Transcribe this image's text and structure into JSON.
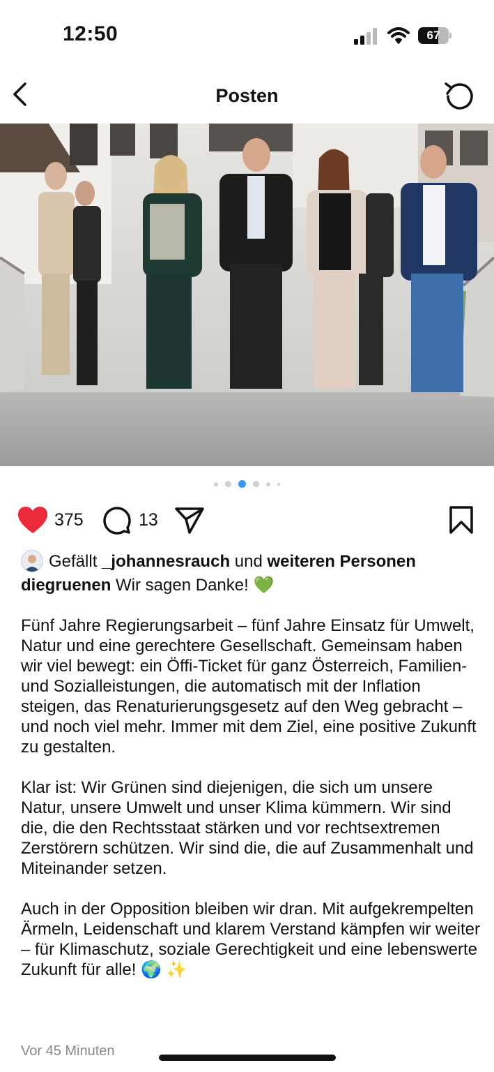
{
  "status_bar": {
    "time": "12:50",
    "battery_level": "67",
    "battery_fraction": 0.67
  },
  "nav": {
    "title": "Posten",
    "back_icon": "chevron-left-icon",
    "refresh_icon": "refresh-icon"
  },
  "carousel": {
    "total": 6,
    "active_index": 2
  },
  "actions": {
    "like_count": "375",
    "comment_count": "13",
    "like_color": "#ed2a3b"
  },
  "likes": {
    "prefix": "Gefällt",
    "user": "_johannesrauch",
    "middle": "und",
    "suffix": "weiteren Personen"
  },
  "post": {
    "author": "diegruenen",
    "headline": "Wir sagen Danke! 💚",
    "paragraphs": [
      "Fünf Jahre Regierungsarbeit – fünf Jahre Einsatz für Umwelt, Natur und eine gerechtere Gesellschaft. Gemeinsam haben wir viel bewegt: ein Öffi-Ticket für ganz Österreich, Familien- und Sozialleistungen, die automatisch mit der Inflation steigen, das Renaturierungsgesetz auf den Weg gebracht – und noch viel mehr. Immer mit dem Ziel, eine positive Zukunft zu gestalten.",
      "Klar ist: Wir Grünen sind diejenigen, die sich um unsere Natur, unsere Umwelt und unser Klima kümmern. Wir sind die, die den Rechtsstaat stärken und vor rechtsextremen Zerstörern schützen. Wir sind die, die auf Zusammenhalt und Miteinander setzen.",
      "Auch in der Opposition bleiben wir dran. Mit aufgekrempelten Ärmeln, Leidenschaft und klarem Verstand kämpfen wir weiter – für Klimaschutz, soziale Gerechtigkeit und eine lebenswerte Zukunft für alle! 🌍 ✨"
    ],
    "timestamp": "Vor 45 Minuten"
  }
}
